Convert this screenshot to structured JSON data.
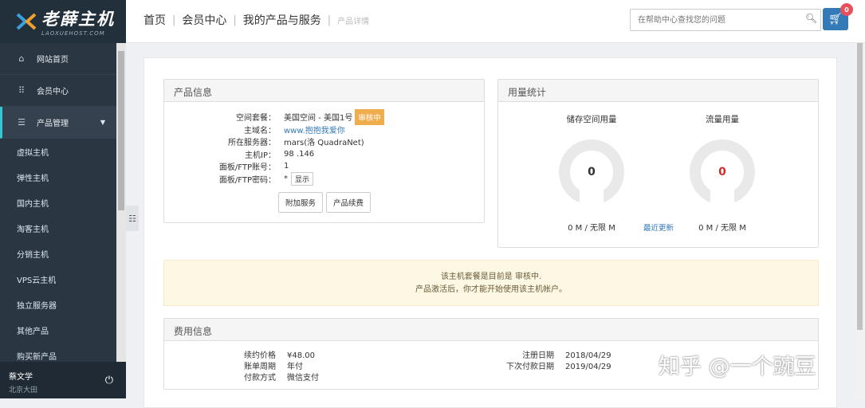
{
  "brand": {
    "name": "老薛主机",
    "sub": "LAOXUEHOST.COM"
  },
  "sidebar": {
    "items": [
      {
        "label": "网站首页",
        "icon": "home-icon"
      },
      {
        "label": "会员中心",
        "icon": "grid-icon"
      },
      {
        "label": "产品管理",
        "icon": "list-icon"
      }
    ],
    "sub_items": [
      "虚拟主机",
      "弹性主机",
      "国内主机",
      "淘客主机",
      "分销主机",
      "VPS云主机",
      "独立服务器",
      "其他产品",
      "购买新产品"
    ],
    "user": {
      "name": "蔡文学",
      "location": "北京大田"
    }
  },
  "header": {
    "crumbs": [
      "首页",
      "会员中心",
      "我的产品与服务"
    ],
    "crumb_last": "产品详情",
    "search_placeholder": "在帮助中心查找您的问题",
    "cart_count": "0"
  },
  "product": {
    "title": "产品信息",
    "rows": [
      {
        "k": "空间套餐：",
        "v": "美国空间 - 美国1号"
      },
      {
        "k": "主域名：",
        "v": "www.抱抱我爱你"
      },
      {
        "k": "所在服务器：",
        "v": "mars(洛 QuadraNet)"
      },
      {
        "k": "主机IP：",
        "v": "98   .146"
      },
      {
        "k": "面板/FTP账号：",
        "v": "1"
      },
      {
        "k": "面板/FTP密码：",
        "v": "*"
      }
    ],
    "status_tag": "审核中",
    "show_label": "显示",
    "btn_addon": "附加服务",
    "btn_renew": "产品续费"
  },
  "usage": {
    "title": "用量统计",
    "storage": {
      "label": "储存空间用量",
      "value": "0",
      "sub": "0 M / 无限 M",
      "value_color": "#333333"
    },
    "traffic": {
      "label": "流量用量",
      "value": "0",
      "sub": "0 M / 无限 M",
      "value_color": "#c9302c"
    },
    "recent": "最近更新"
  },
  "notice": {
    "line1": "该主机套餐是目前是 审核中.",
    "line2": "产品激活后，你才能开始使用该主机帐户。"
  },
  "fees": {
    "title": "费用信息",
    "left": [
      {
        "k": "续约价格",
        "v": "¥48.00"
      },
      {
        "k": "账单周期",
        "v": "年付"
      },
      {
        "k": "付款方式",
        "v": "微信支付"
      }
    ],
    "right": [
      {
        "k": "注册日期",
        "v": "2018/04/29"
      },
      {
        "k": "下次付款日期",
        "v": "2019/04/29"
      }
    ]
  },
  "watermark": "知乎 @一个豌豆"
}
